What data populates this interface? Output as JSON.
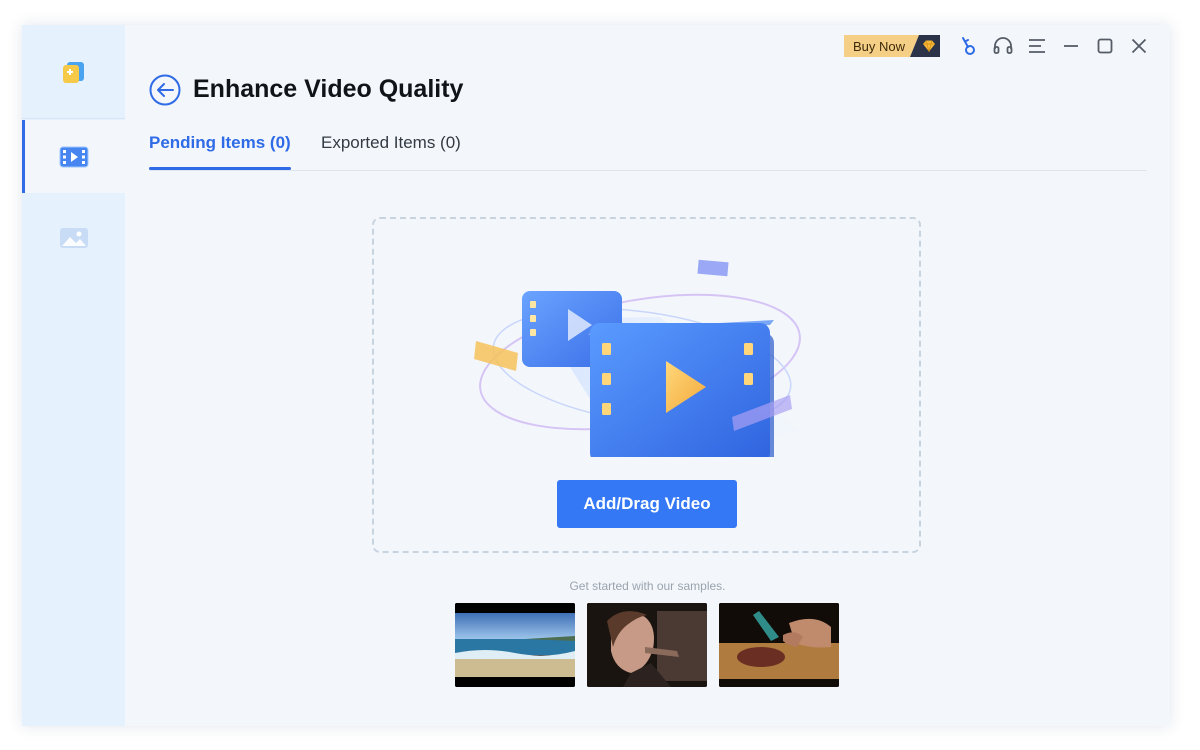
{
  "window": {
    "title": "Enhance Video Quality"
  },
  "sidebar": {
    "items": [
      {
        "icon": "app-logo-icon",
        "active": false
      },
      {
        "icon": "video-enhance-icon",
        "active": true
      },
      {
        "icon": "image-enhance-icon",
        "active": false
      }
    ]
  },
  "titlebar": {
    "buy_now_label": "Buy Now",
    "buttons": [
      "key-icon",
      "headset-icon",
      "menu-icon",
      "minimize-icon",
      "maximize-icon",
      "close-icon"
    ]
  },
  "tabs": [
    {
      "label": "Pending Items (0)",
      "active": true
    },
    {
      "label": "Exported Items (0)",
      "active": false
    }
  ],
  "dropzone": {
    "button_label": "Add/Drag Video"
  },
  "samples": {
    "caption": "Get started with our samples.",
    "items": [
      {
        "subject": "beach"
      },
      {
        "subject": "woman-portrait"
      },
      {
        "subject": "cutting-meat"
      }
    ]
  },
  "colors": {
    "accent": "#2f6be6",
    "button": "#3478f6",
    "buy_now": "#f6cf86",
    "sidebar_bg": "#e5f1fd",
    "main_bg": "#f3f7fc"
  }
}
